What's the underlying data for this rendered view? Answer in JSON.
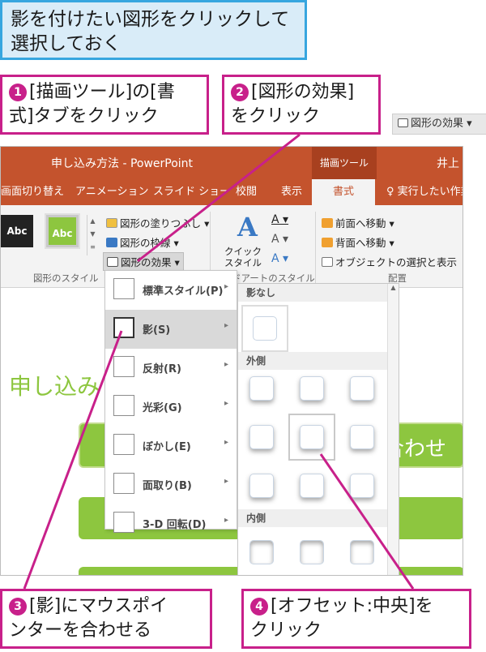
{
  "top_note": {
    "line1": "影を付けたい図形をクリックして",
    "line2": "選択しておく"
  },
  "callouts": {
    "c1": {
      "num": "1",
      "line1": "[描画ツール]の[書",
      "line2": "式]タブをクリック"
    },
    "c2": {
      "num": "2",
      "line1": "[図形の効果]",
      "line2": "をクリック"
    },
    "c3": {
      "num": "3",
      "line1": "[影]にマウスポイ",
      "line2": "ンターを合わせる"
    },
    "c4": {
      "num": "4",
      "line1": "[オフセット:中央]を",
      "line2": "クリック"
    }
  },
  "effect_chip": {
    "label": "図形の効果",
    "arrow": "▾"
  },
  "titlebar": {
    "title": "申し込み方法 - PowerPoint",
    "context": "描画ツール",
    "user": "井上"
  },
  "tabs": [
    {
      "label": "画面切り替え"
    },
    {
      "label": "アニメーション"
    },
    {
      "label": "スライド ショー"
    },
    {
      "label": "校閲"
    },
    {
      "label": "表示"
    },
    {
      "label": "書式"
    },
    {
      "label": "♀ 実行したい作業"
    }
  ],
  "ribbon": {
    "abc1": "Abc",
    "abc2": "Abc",
    "fill": "図形の塗りつぶし",
    "outline": "図形の枠線",
    "effect": "図形の効果",
    "group_styles": "図形のスタイル",
    "quick_line1": "クイック",
    "quick_line2": "スタイル",
    "group_wordart": "ワードアートのスタイル",
    "front": "前面へ移動",
    "back": "背面へ移動",
    "select_pane": "オブジェクトの選択と表示",
    "group_arrange": "配置"
  },
  "slide": {
    "title": "申し込み",
    "bar1": "合わせ"
  },
  "menu_items": [
    {
      "label": "標準スタイル(P)"
    },
    {
      "label": "影(S)"
    },
    {
      "label": "反射(R)"
    },
    {
      "label": "光彩(G)"
    },
    {
      "label": "ぼかし(E)"
    },
    {
      "label": "面取り(B)"
    },
    {
      "label": "3-D 回転(D)"
    }
  ],
  "gallery": {
    "none": "影なし",
    "outer": "外側",
    "inner": "内側"
  },
  "colors": {
    "accent": "#c8208a",
    "ribbon": "#c4532d",
    "note_border": "#37a6df",
    "slide_green": "#8dc63f"
  }
}
